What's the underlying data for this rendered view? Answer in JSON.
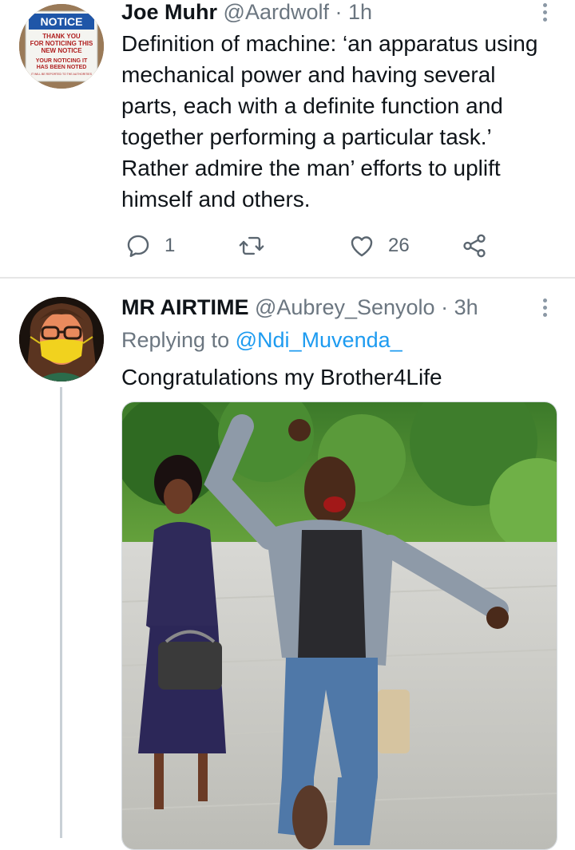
{
  "tweets": [
    {
      "name": "Joe Muhr",
      "handle": "@Aardwolf",
      "separator": "·",
      "time": "1h",
      "avatar_sign": {
        "title": "NOTICE",
        "line1": "THANK YOU",
        "line2": "FOR NOTICING THIS",
        "line3": "NEW NOTICE",
        "line4": "YOUR NOTICING IT",
        "line5": "HAS BEEN NOTED",
        "line6": "IT WILL BE REPORTED TO THE AUTHORITIES"
      },
      "text": "Definition of machine: ‘an apparatus using mechanical power and having several parts, each with a definite function and together performing a particular task.’ Rather admire the man’ efforts to uplift himself and others.",
      "actions": {
        "reply_icon": "reply-icon",
        "reply_count": "1",
        "retweet_icon": "retweet-icon",
        "like_icon": "heart-icon",
        "like_count": "26",
        "share_icon": "share-icon"
      }
    },
    {
      "name": "MR AIRTIME",
      "handle": "@Aubrey_Senyolo",
      "separator": "·",
      "time": "3h",
      "replying_prefix": "Replying to",
      "replying_to": "@Ndi_Muvenda_",
      "text": "Congratulations my Brother4Life",
      "media_icon": "photo-celebrating-man"
    }
  ],
  "colors": {
    "link": "#1d9bf0",
    "secondary_text": "#6b7680",
    "primary_text": "#0f1419",
    "divider": "#e6e6e6",
    "thread_line": "#c9d0d6"
  }
}
